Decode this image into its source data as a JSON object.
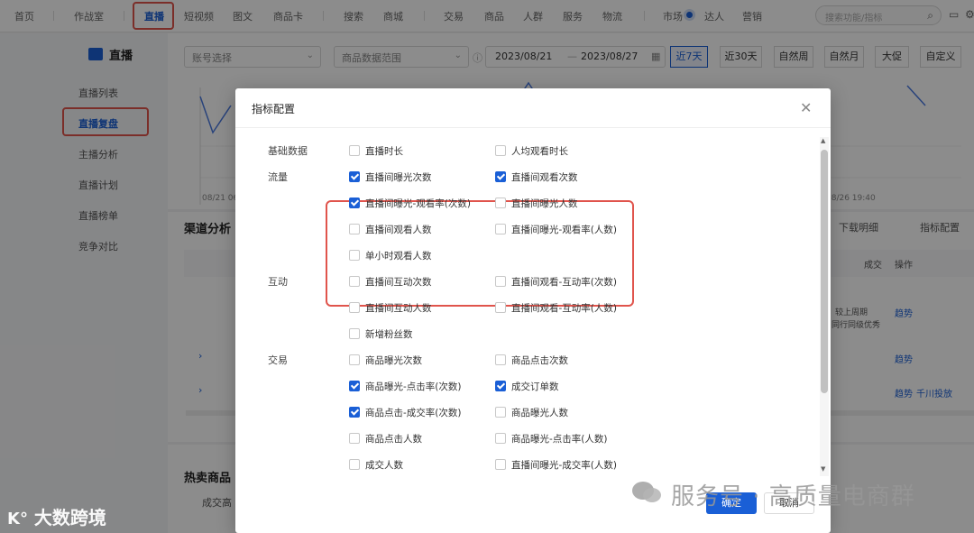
{
  "topnav": {
    "items": [
      "首页",
      "作战室",
      "直播",
      "短视频",
      "图文",
      "商品卡",
      "搜索",
      "商城",
      "交易",
      "商品",
      "人群",
      "服务",
      "物流",
      "市场",
      "达人",
      "营销"
    ],
    "active_index": 2,
    "search_placeholder": "搜索功能/指标"
  },
  "sidebar": {
    "title": "直播",
    "items": [
      "直播列表",
      "直播复盘",
      "主播分析",
      "直播计划",
      "直播榜单",
      "竞争对比"
    ],
    "active_index": 1
  },
  "filter": {
    "account_placeholder": "账号选择",
    "scope_placeholder": "商品数据范围",
    "date_start": "2023/08/21",
    "date_sep": "—",
    "date_end": "2023/08/27",
    "periods": [
      "近7天",
      "近30天",
      "自然周",
      "自然月",
      "大促",
      "自定义"
    ],
    "active_period": 0
  },
  "background": {
    "chart_tick_left": "08/21 06",
    "chart_tick_right": "08/26 19:40",
    "channel_title": "渠道分析",
    "download_label": "下载明细",
    "metric_config_label": "指标配置",
    "col_deal": "成交",
    "col_ops": "操作",
    "compare_text": "较上周期",
    "peer_text": "同行同级优秀",
    "trend": "趋势",
    "qianchuan": "千川投放",
    "hot_title": "热卖商品",
    "deal_high": "成交高"
  },
  "modal": {
    "title": "指标配置",
    "confirm": "确定",
    "cancel": "取消",
    "groups": [
      {
        "label": "基础数据",
        "rows": [
          [
            {
              "text": "直播时长",
              "checked": false
            },
            {
              "text": "人均观看时长",
              "checked": false
            }
          ]
        ]
      },
      {
        "label": "流量",
        "rows": [
          [
            {
              "text": "直播间曝光次数",
              "checked": true
            },
            {
              "text": "直播间观看次数",
              "checked": true
            }
          ],
          [
            {
              "text": "直播间曝光-观看率(次数)",
              "checked": true
            },
            {
              "text": "直播间曝光人数",
              "checked": false
            }
          ],
          [
            {
              "text": "直播间观看人数",
              "checked": false
            },
            {
              "text": "直播间曝光-观看率(人数)",
              "checked": false
            }
          ],
          [
            {
              "text": "单小时观看人数",
              "checked": false
            }
          ]
        ]
      },
      {
        "label": "互动",
        "rows": [
          [
            {
              "text": "直播间互动次数",
              "checked": false
            },
            {
              "text": "直播间观看-互动率(次数)",
              "checked": false
            }
          ],
          [
            {
              "text": "直播间互动人数",
              "checked": false
            },
            {
              "text": "直播间观看-互动率(人数)",
              "checked": false
            }
          ],
          [
            {
              "text": "新增粉丝数",
              "checked": false
            }
          ]
        ]
      },
      {
        "label": "交易",
        "rows": [
          [
            {
              "text": "商品曝光次数",
              "checked": false
            },
            {
              "text": "商品点击次数",
              "checked": false
            }
          ],
          [
            {
              "text": "商品曝光-点击率(次数)",
              "checked": true
            },
            {
              "text": "成交订单数",
              "checked": true
            }
          ],
          [
            {
              "text": "商品点击-成交率(次数)",
              "checked": true
            },
            {
              "text": "商品曝光人数",
              "checked": false
            }
          ],
          [
            {
              "text": "商品点击人数",
              "checked": false
            },
            {
              "text": "商品曝光-点击率(人数)",
              "checked": false
            }
          ],
          [
            {
              "text": "成交人数",
              "checked": false
            },
            {
              "text": "直播间曝光-成交率(人数)",
              "checked": false
            }
          ]
        ]
      }
    ]
  },
  "watermark": {
    "right": "服务号 · 高质量电商群",
    "left": "大数跨境"
  }
}
